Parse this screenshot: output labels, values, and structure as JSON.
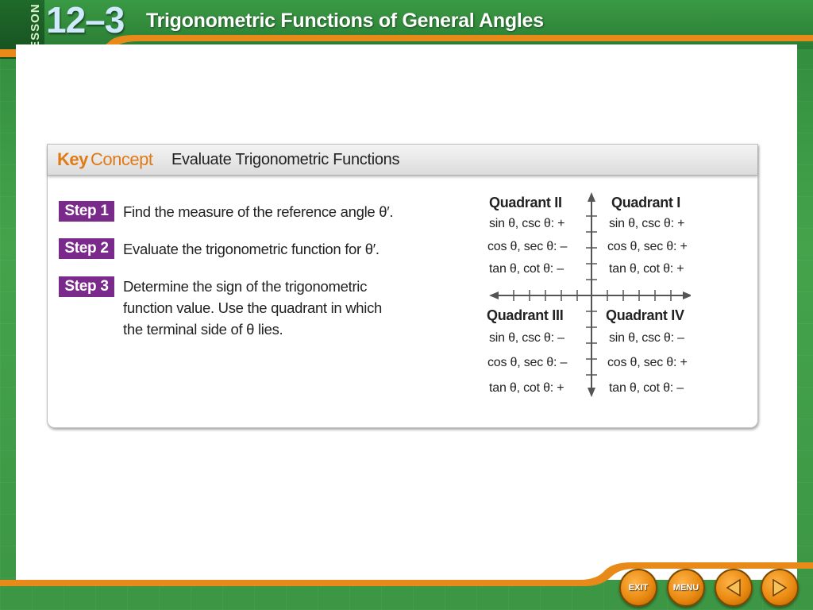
{
  "header": {
    "lesson_label": "LESSON",
    "lesson_number": "12–3",
    "title": "Trigonometric Functions of General Angles"
  },
  "key_concept": {
    "label_key": "Key",
    "label_concept": "Concept",
    "title": "Evaluate Trigonometric Functions"
  },
  "steps": [
    {
      "badge": "Step 1",
      "lines": [
        "Find the measure of the reference angle θ′."
      ]
    },
    {
      "badge": "Step 2",
      "lines": [
        "Evaluate the trigonometric function for θ′."
      ]
    },
    {
      "badge": "Step 3",
      "lines": [
        "Determine the sign of the trigonometric",
        "function value. Use the quadrant in which",
        "the terminal side of θ lies."
      ]
    }
  ],
  "quadrants": {
    "q2": {
      "title": "Quadrant II",
      "rows": [
        "sin θ, csc θ: +",
        "cos θ, sec θ: –",
        "tan θ, cot θ: –"
      ]
    },
    "q1": {
      "title": "Quadrant I",
      "rows": [
        "sin θ, csc θ: +",
        "cos θ, sec θ: +",
        "tan θ, cot θ: +"
      ]
    },
    "q3": {
      "title": "Quadrant III",
      "rows": [
        "sin θ, csc θ: –",
        "cos θ, sec θ: –",
        "tan θ, cot θ: +"
      ]
    },
    "q4": {
      "title": "Quadrant IV",
      "rows": [
        "sin θ, csc θ: –",
        "cos θ, sec θ: +",
        "tan θ, cot θ: –"
      ]
    }
  },
  "nav": {
    "exit_label": "EXIT",
    "menu_label": "MENU",
    "back_icon": "left-triangle-icon",
    "next_icon": "right-triangle-icon"
  },
  "colors": {
    "frame_green": "#3f9a46",
    "accent_orange": "#e07a16",
    "step_purple": "#7a2a8a"
  }
}
